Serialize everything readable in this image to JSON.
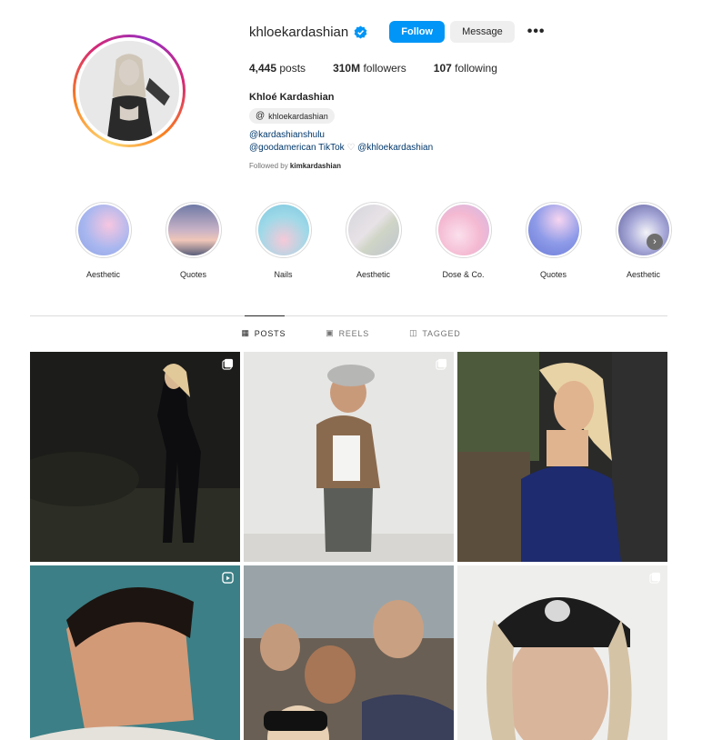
{
  "profile": {
    "username": "khloekardashian",
    "follow_label": "Follow",
    "message_label": "Message",
    "more_label": "•••",
    "posts_count": "4,445",
    "posts_label": "posts",
    "followers_count": "310M",
    "followers_label": "followers",
    "following_count": "107",
    "following_label": "following",
    "full_name": "Khloé Kardashian",
    "threads_handle": "khloekardashian",
    "bio_line1": "@kardashianshulu",
    "bio_line2_a": "@goodamerican TikTok",
    "bio_line2_heart": "♡",
    "bio_line2_b": "@khloekardashian",
    "followed_by_prefix": "Followed by",
    "followed_by_user": "kimkardashian"
  },
  "highlights": [
    {
      "label": "Aesthetic"
    },
    {
      "label": "Quotes"
    },
    {
      "label": "Nails"
    },
    {
      "label": "Aesthetic"
    },
    {
      "label": "Dose & Co."
    },
    {
      "label": "Quotes"
    },
    {
      "label": "Aesthetic"
    }
  ],
  "tabs": {
    "posts": "POSTS",
    "reels": "REELS",
    "tagged": "TAGGED"
  },
  "colors": {
    "accent": "#0095f6",
    "verified": "#0095f6"
  }
}
